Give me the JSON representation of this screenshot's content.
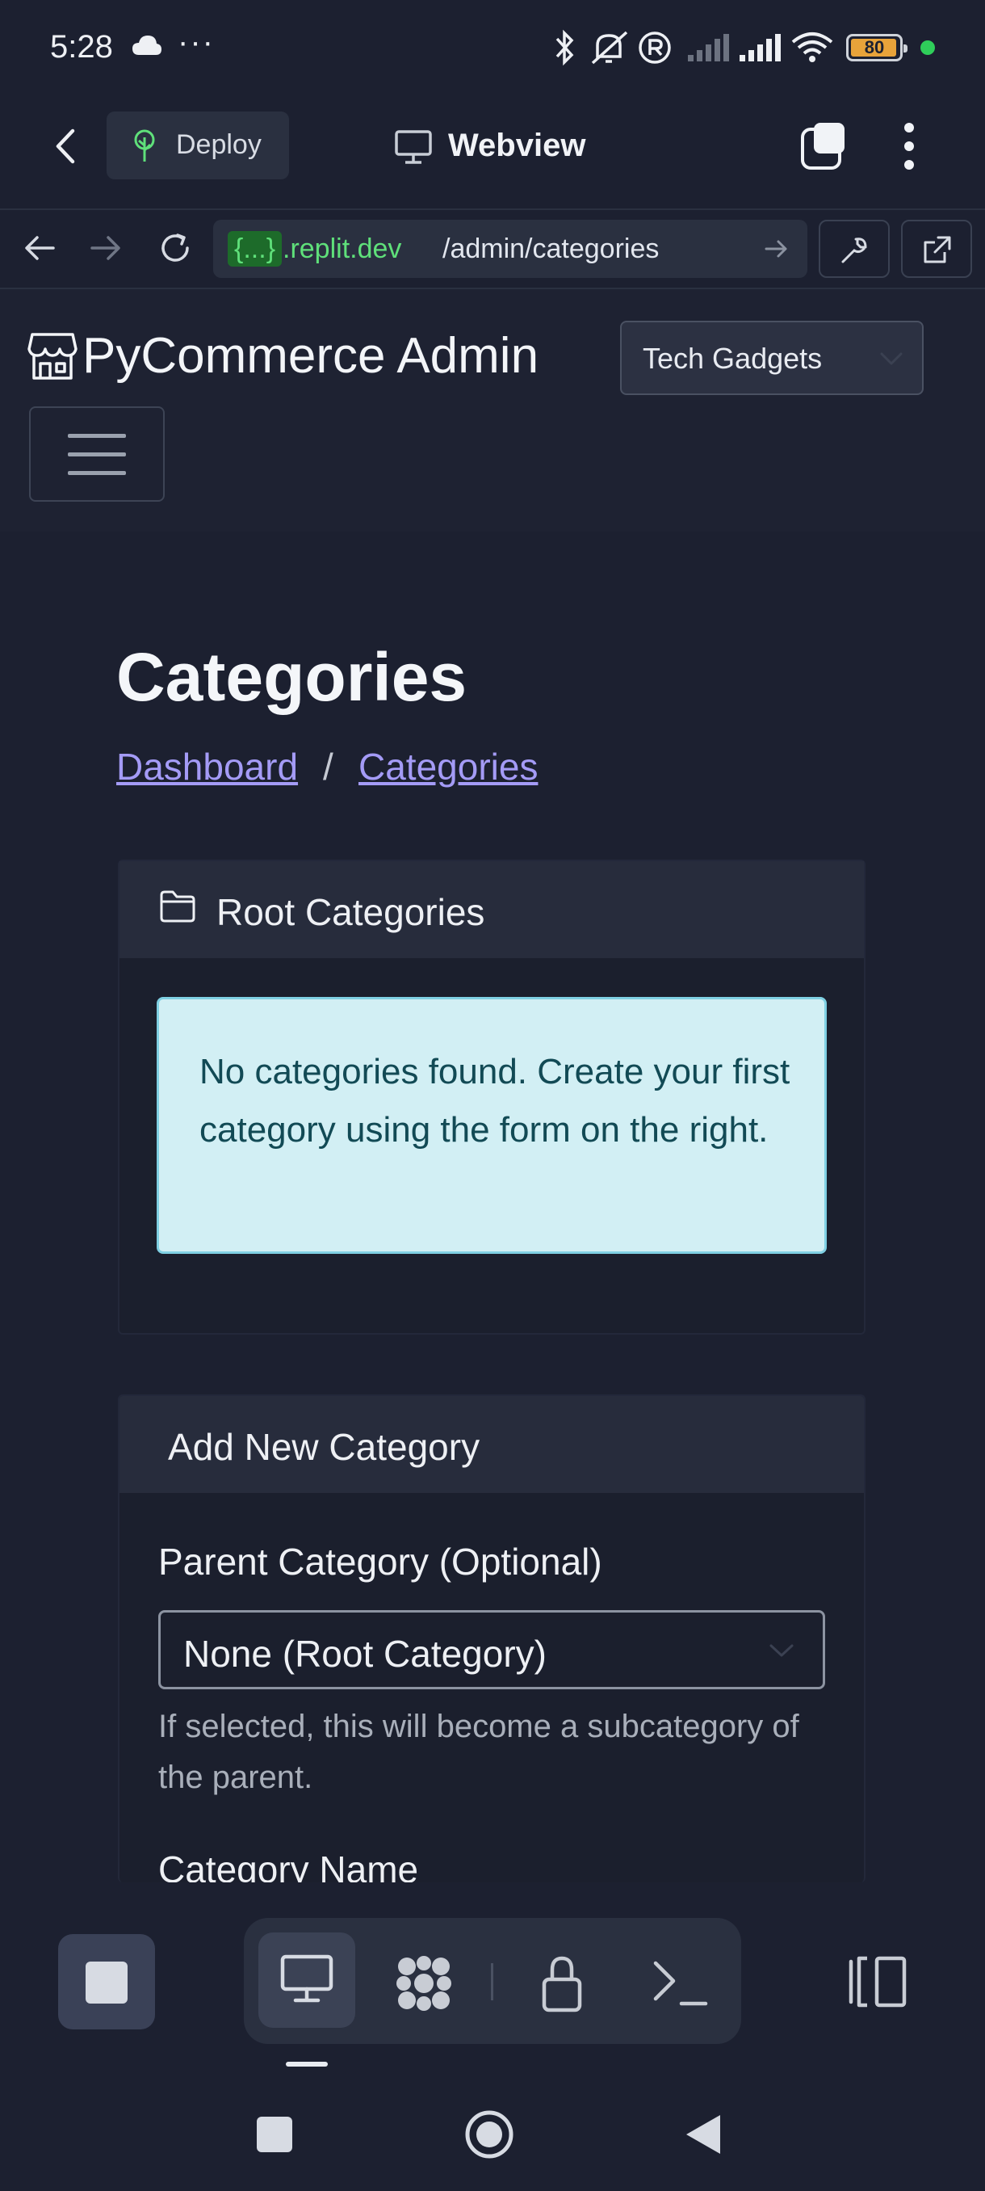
{
  "status_bar": {
    "time": "5:28",
    "overflow": "···",
    "battery": "80",
    "icons": [
      "cloud-icon",
      "bluetooth-icon",
      "mute-icon",
      "registered-icon",
      "signal-icon",
      "signal-icon",
      "wifi-icon",
      "battery-icon"
    ]
  },
  "toolbar": {
    "back_icon": "chevron-left-icon",
    "deploy_label": "Deploy",
    "title": "Webview",
    "title_icon": "monitor-icon"
  },
  "url_bar": {
    "tag": "{...}",
    "host": ".replit.dev",
    "path": "/admin/categories"
  },
  "navbar": {
    "brand": "PyCommerce Admin",
    "store_select": "Tech Gadgets"
  },
  "page": {
    "title": "Categories",
    "breadcrumb": {
      "dashboard": "Dashboard",
      "separator": "/",
      "current": "Categories"
    }
  },
  "root_categories": {
    "header": "Root Categories",
    "empty_message": "No categories found. Create your first category using the form on the right."
  },
  "add_category": {
    "header": "Add New Category",
    "parent_label": "Parent Category (Optional)",
    "parent_value": "None (Root Category)",
    "parent_help": "If selected, this will become a subcategory of the parent.",
    "name_label": "Category Name"
  },
  "colors": {
    "background": "#1c2030",
    "card_header": "#272c3c",
    "link": "#a49bf6",
    "alert_bg": "#d2eff4",
    "alert_text": "#124a55",
    "replit_green": "#5fe07a"
  }
}
